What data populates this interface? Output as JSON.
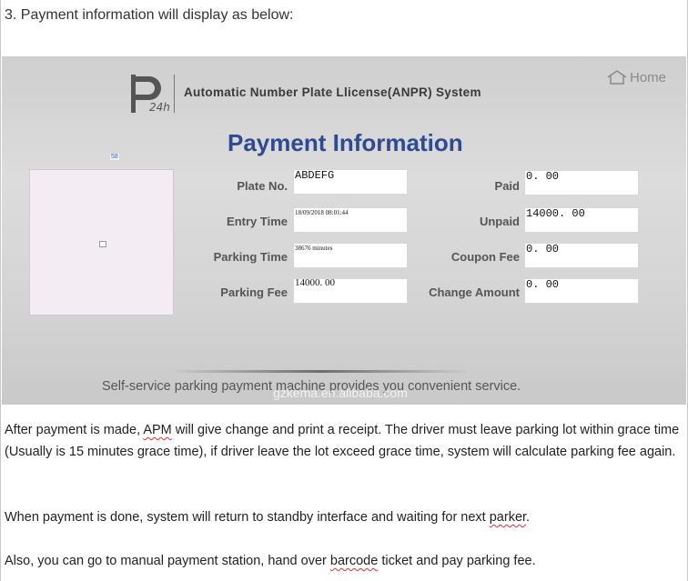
{
  "step_text": "3. Payment information will display as below:",
  "panel": {
    "system_title": "Automatic Number Plate Llicense(ANPR) System",
    "home_label": "Home",
    "payment_title": "Payment Information",
    "photo_badge": "58",
    "fields": {
      "plate_no": {
        "label": "Plate No.",
        "value": "ABDEFG"
      },
      "entry_time": {
        "label": "Entry Time",
        "value": "18/09/2018 08:01:44"
      },
      "parking_time": {
        "label": "Parking Time",
        "value": "38676 minutes"
      },
      "parking_fee": {
        "label": "Parking Fee",
        "value": "14000. 00"
      },
      "paid": {
        "label": "Paid",
        "value": "0. 00"
      },
      "unpaid": {
        "label": "Unpaid",
        "value": "14000. 00"
      },
      "coupon_fee": {
        "label": "Coupon Fee",
        "value": "0. 00"
      },
      "change_amount": {
        "label": "Change Amount",
        "value": "0. 00"
      }
    },
    "slogan": "Self-service parking payment machine provides you convenient service.",
    "watermark": "gzkema.en.alibaba.com"
  },
  "paragraphs": {
    "p1_prefix": "After payment is made, ",
    "p1_apm": "APM",
    "p1_suffix": " will give change and print a receipt. The driver must leave parking lot within grace time (Usually is 15 minutes grace time), if driver leave the lot exceed grace time, system will calculate parking fee again.",
    "p2_prefix": "When payment is done, system will return to standby interface and waiting for next ",
    "p2_parker": "parker",
    "p2_suffix": ".",
    "p3_prefix": "Also, you can go to manual payment station, hand over ",
    "p3_barcode": "barcode",
    "p3_suffix": " ticket and pay parking fee."
  },
  "icons": {
    "logo": "p24h-logo",
    "home": "house-outline-icon",
    "photo": "broken-image-icon"
  },
  "colors": {
    "title_blue": "#2d4a93",
    "panel_gray": "#d6d6d6",
    "spell_underline": "#dd3333"
  }
}
